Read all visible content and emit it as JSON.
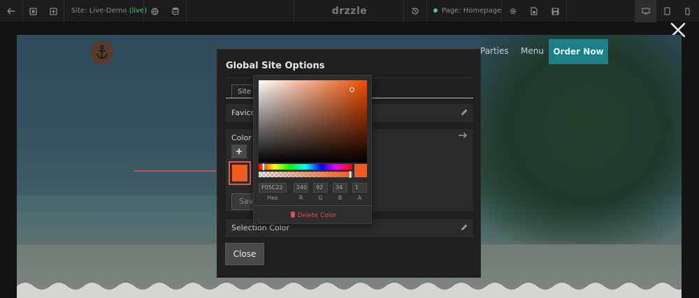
{
  "toolbar": {
    "site_prefix": "Site: Live-Demo",
    "site_status": "(live)",
    "brand": "drzzle",
    "page_label": "Page: Homepage",
    "icons": [
      "back-arrow-icon",
      "copy-icon",
      "add-page-icon",
      "globe-icon",
      "database-icon",
      "history-icon",
      "gear-icon",
      "file-icon",
      "save-icon",
      "desktop-icon",
      "tablet-icon",
      "mobile-icon"
    ]
  },
  "preview": {
    "nav_parties": "Parties",
    "nav_menu": "Menu",
    "order_button": "Order Now",
    "accent_color": "#1d7f87"
  },
  "modal": {
    "title": "Global Site Options",
    "tab_label": "Site M",
    "favicon_label": "Favico",
    "color_label": "Color P",
    "plus_label": "+",
    "save_label": "Save",
    "selection_label": "Selection Color",
    "close_label": "Close"
  },
  "picker": {
    "selected_color": "#F05C22",
    "hex": "F05C22",
    "r": "240",
    "g": "92",
    "b": "34",
    "a": "1",
    "labels": {
      "hex": "Hex",
      "r": "R",
      "g": "G",
      "b": "B",
      "a": "A"
    },
    "delete_label": "Delete Color"
  },
  "annotation_color": "#e05a5a"
}
